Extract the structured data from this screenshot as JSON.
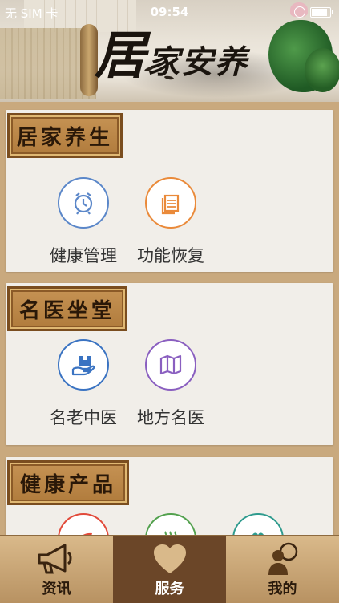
{
  "status": {
    "carrier": "无 SIM 卡",
    "time": "09:54"
  },
  "banner": {
    "title_big": "居",
    "title_rest": "家安养"
  },
  "sections": [
    {
      "title": "居家养生",
      "items": [
        {
          "label": "健康管理",
          "icon": "clock-icon",
          "color": "#5b87c9"
        },
        {
          "label": "功能恢复",
          "icon": "document-stack-icon",
          "color": "#ea8a3a"
        }
      ]
    },
    {
      "title": "名医坐堂",
      "items": [
        {
          "label": "名老中医",
          "icon": "hand-box-icon",
          "color": "#3a73c2"
        },
        {
          "label": "地方名医",
          "icon": "map-icon",
          "color": "#8a5fc0"
        }
      ]
    },
    {
      "title": "健康产品",
      "items": [
        {
          "label": "",
          "icon": "leaf-icon",
          "color": "#e24a3a"
        },
        {
          "label": "",
          "icon": "steam-bowl-icon",
          "color": "#53a14e"
        },
        {
          "label": "",
          "icon": "heart-plant-icon",
          "color": "#2f9b8e"
        }
      ]
    }
  ],
  "tabs": [
    {
      "label": "资讯",
      "icon": "megaphone-icon"
    },
    {
      "label": "服务",
      "icon": "heart-icon",
      "active": true
    },
    {
      "label": "我的",
      "icon": "person-chat-icon"
    }
  ]
}
